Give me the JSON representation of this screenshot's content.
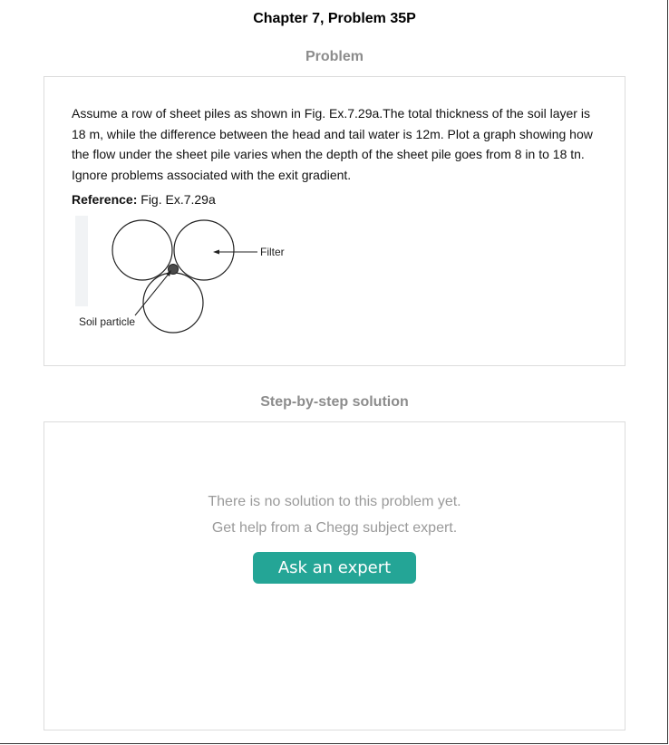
{
  "header": {
    "title": "Chapter 7, Problem 35P"
  },
  "problem": {
    "heading": "Problem",
    "text": "Assume a row of sheet piles as shown in Fig. Ex.7.29a.The total thickness of the soil layer is 18 m, while the difference between the head and tail water is 12m. Plot a graph showing how the flow under the sheet pile varies when the depth of the sheet pile goes from 8 in to 18 tn. Ignore problems associated with the exit gradient.",
    "reference_label": "Reference:",
    "reference_value": " Fig. Ex.7.29a",
    "figure": {
      "filter_label": "Filter",
      "particle_label": "Soil particle"
    }
  },
  "solution": {
    "heading": "Step-by-step solution",
    "empty_line1": "There is no solution to this problem yet.",
    "empty_line2": "Get help from a Chegg subject expert.",
    "ask_button": "Ask an expert"
  },
  "colors": {
    "button": "#24a596",
    "heading_gray": "#8c8c8c",
    "message_gray": "#9a9a9a"
  }
}
